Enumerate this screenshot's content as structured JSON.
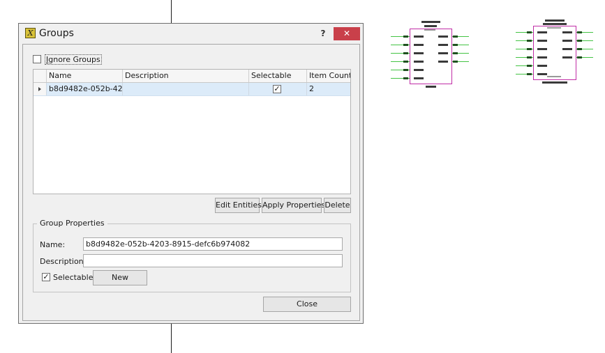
{
  "dialog": {
    "icon_glyph": "X",
    "title": "Groups",
    "help_label": "?",
    "close_glyph": "✕"
  },
  "ignore_groups": {
    "label_prefix": "I",
    "label_rest": "gnore Groups",
    "checked": false
  },
  "grid": {
    "columns": [
      "Name",
      "Description",
      "Selectable",
      "Item Count"
    ],
    "rows": [
      {
        "name": "b8d9482e-052b-42…",
        "description": "",
        "selectable": "✓",
        "item_count": "2"
      }
    ]
  },
  "buttons": {
    "edit_entities": "Edit Entities",
    "apply_properties": "Apply Properties",
    "delete": "Delete",
    "new": "New",
    "close": "Close"
  },
  "group_properties": {
    "legend": "Group Properties",
    "name_label": "Name:",
    "name_value": "b8d9482e-052b-4203-8915-defc6b974082",
    "description_label": "Description:",
    "description_value": "",
    "selectable_label": "Selectable",
    "selectable_check": "✓"
  },
  "colors": {
    "close_button": "#c9404a",
    "row_selected": "#dcebf9",
    "component_outline": "#c02ca6",
    "pin_green": "#43c343"
  }
}
